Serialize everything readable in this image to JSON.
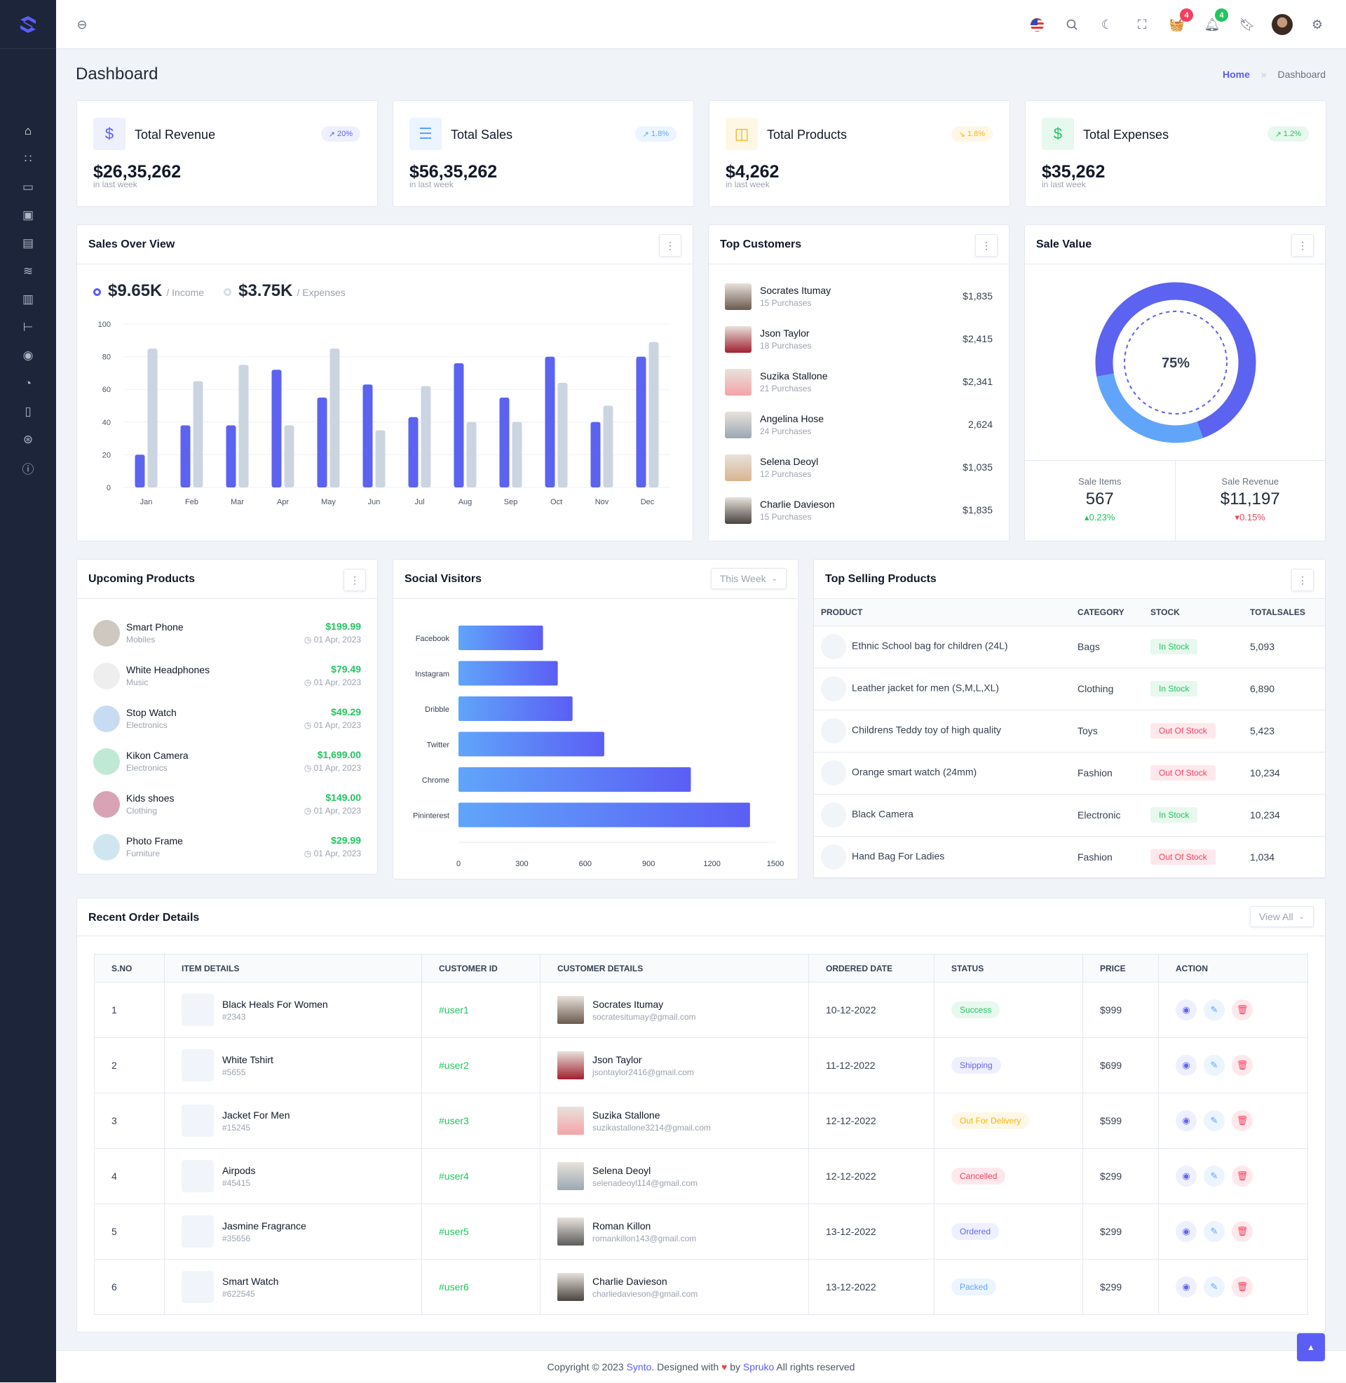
{
  "colors": {
    "primary": "#5b5ef4",
    "secondary": "#cbd5e1",
    "success": "#22c55e",
    "danger": "#ef4444",
    "warning": "#f59e0b",
    "info": "#60a5fa",
    "sidebar": "#1c2539"
  },
  "sidebar": {
    "items": [
      {
        "icon": "home-icon",
        "active": true
      },
      {
        "icon": "apps-icon"
      },
      {
        "icon": "inbox-icon"
      },
      {
        "icon": "chip-icon"
      },
      {
        "icon": "file-icon"
      },
      {
        "icon": "layers-icon"
      },
      {
        "icon": "report-icon"
      },
      {
        "icon": "tree-icon"
      },
      {
        "icon": "map-pin-icon"
      },
      {
        "icon": "pie-chart-icon"
      },
      {
        "icon": "book-icon"
      },
      {
        "icon": "aperture-icon"
      },
      {
        "icon": "alert-icon"
      }
    ]
  },
  "header": {
    "cart_count": "4",
    "notification_count": "4"
  },
  "page": {
    "title": "Dashboard",
    "breadcrumb": {
      "home": "Home",
      "sep": "»",
      "current": "Dashboard"
    }
  },
  "stats": [
    {
      "title": "Total Revenue",
      "value": "$26,35,262",
      "sub": "in last week",
      "change": "20%",
      "trend": "up",
      "color": "#5b5ef4",
      "bg": "#eef0ff",
      "icon": "receipt-dollar-icon",
      "glyph": "$"
    },
    {
      "title": "Total Sales",
      "value": "$56,35,262",
      "sub": "in last week",
      "change": "1.8%",
      "trend": "up",
      "color": "#60a5fa",
      "bg": "#ebf4ff",
      "icon": "receipt-icon",
      "glyph": "☰"
    },
    {
      "title": "Total Products",
      "value": "$4,262",
      "sub": "in last week",
      "change": "1.8%",
      "trend": "down",
      "color": "#f5b60b",
      "bg": "#fff7e6",
      "icon": "shopping-bag-icon",
      "glyph": "◫"
    },
    {
      "title": "Total Expenses",
      "value": "$35,262",
      "sub": "in last week",
      "change": "1.2%",
      "trend": "up",
      "color": "#22c55e",
      "bg": "#e7f8ee",
      "icon": "dollar-circle-icon",
      "glyph": "$"
    }
  ],
  "sales_overview": {
    "title": "Sales Over View",
    "income_value": "$9.65K",
    "income_label": "/ Income",
    "expense_value": "$3.75K",
    "expense_label": "/ Expenses"
  },
  "chart_data": [
    {
      "type": "bar",
      "categories": [
        "Jan",
        "Feb",
        "Mar",
        "Apr",
        "May",
        "Jun",
        "Jul",
        "Aug",
        "Sep",
        "Oct",
        "Nov",
        "Dec"
      ],
      "series": [
        {
          "name": "Income",
          "values": [
            20,
            38,
            38,
            72,
            55,
            63,
            43,
            76,
            55,
            80,
            40,
            80
          ],
          "color": "#5b63f0"
        },
        {
          "name": "Expenses",
          "values": [
            85,
            65,
            75,
            38,
            85,
            35,
            62,
            40,
            40,
            64,
            50,
            89
          ],
          "color": "#cbd5e1"
        }
      ],
      "ylim": [
        0,
        100
      ],
      "yticks": [
        0,
        20,
        40,
        60,
        80,
        100
      ],
      "grid": true
    },
    {
      "type": "bar",
      "orientation": "horizontal",
      "categories": [
        "Facebook",
        "Instagram",
        "Dribble",
        "Twitter",
        "Chrome",
        "Pininterest"
      ],
      "values": [
        400,
        470,
        540,
        690,
        1100,
        1380
      ],
      "xlim": [
        0,
        1500
      ],
      "xticks": [
        0,
        300,
        600,
        900,
        1200,
        1500
      ]
    },
    {
      "type": "pie",
      "variant": "donut",
      "label": "75%",
      "value": 75
    }
  ],
  "top_customers": {
    "title": "Top Customers",
    "items": [
      {
        "name": "Socrates Itumay",
        "sub": "15 Purchases",
        "amount": "$1,835",
        "color": "#6b5a4e"
      },
      {
        "name": "Json Taylor",
        "sub": "18 Purchases",
        "amount": "$2,415",
        "color": "#a0202f"
      },
      {
        "name": "Suzika Stallone",
        "sub": "21 Purchases",
        "amount": "$2,341",
        "color": "#f4a3a8"
      },
      {
        "name": "Angelina Hose",
        "sub": "24 Purchases",
        "amount": "2,624",
        "color": "#9aa8b3"
      },
      {
        "name": "Selena Deoyl",
        "sub": "12 Purchases",
        "amount": "$1,035",
        "color": "#d9b48f"
      },
      {
        "name": "Charlie Davieson",
        "sub": "15 Purchases",
        "amount": "$1,835",
        "color": "#4a4440"
      }
    ]
  },
  "sale_value": {
    "title": "Sale Value",
    "items_label": "Sale Items",
    "items_value": "567",
    "items_change": "0.23%",
    "revenue_label": "Sale Revenue",
    "revenue_value": "$11,197",
    "revenue_change": "0.15%"
  },
  "upcoming": {
    "title": "Upcoming Products",
    "items": [
      {
        "name": "Smart Phone",
        "sub": "Mobiles",
        "price": "$199.99",
        "date": "01 Apr, 2023",
        "color": "#cfc8c0"
      },
      {
        "name": "White Headphones",
        "sub": "Music",
        "price": "$79.49",
        "date": "01 Apr, 2023",
        "color": "#eeeeee"
      },
      {
        "name": "Stop Watch",
        "sub": "Electronics",
        "price": "$49.29",
        "date": "01 Apr, 2023",
        "color": "#c7dcf3"
      },
      {
        "name": "Kikon Camera",
        "sub": "Electronics",
        "price": "$1,699.00",
        "date": "01 Apr, 2023",
        "color": "#bfe9d4"
      },
      {
        "name": "Kids shoes",
        "sub": "Clothing",
        "price": "$149.00",
        "date": "01 Apr, 2023",
        "color": "#d8a3b4"
      },
      {
        "name": "Photo Frame",
        "sub": "Furniture",
        "price": "$29.99",
        "date": "01 Apr, 2023",
        "color": "#cfe6f0"
      }
    ]
  },
  "social": {
    "title": "Social Visitors",
    "filter": "This Week"
  },
  "top_selling": {
    "title": "Top Selling Products",
    "columns": [
      "PRODUCT",
      "CATEGORY",
      "STOCK",
      "TOTALSALES"
    ],
    "rows": [
      {
        "product": "Ethnic School bag for children (24L)",
        "category": "Bags",
        "stock": "In Stock",
        "sales": "5,093",
        "in": true
      },
      {
        "product": "Leather jacket for men (S,M,L,XL)",
        "category": "Clothing",
        "stock": "In Stock",
        "sales": "6,890",
        "in": true
      },
      {
        "product": "Childrens Teddy toy of high quality",
        "category": "Toys",
        "stock": "Out Of Stock",
        "sales": "5,423",
        "in": false
      },
      {
        "product": "Orange smart watch (24mm)",
        "category": "Fashion",
        "stock": "Out Of Stock",
        "sales": "10,234",
        "in": false
      },
      {
        "product": "Black Camera",
        "category": "Electronic",
        "stock": "In Stock",
        "sales": "10,234",
        "in": true
      },
      {
        "product": "Hand Bag For Ladies",
        "category": "Fashion",
        "stock": "Out Of Stock",
        "sales": "1,034",
        "in": false
      }
    ]
  },
  "orders": {
    "title": "Recent Order Details",
    "view_all": "View All",
    "columns": [
      "S.NO",
      "ITEM DETAILS",
      "CUSTOMER ID",
      "CUSTOMER DETAILS",
      "ORDERED DATE",
      "STATUS",
      "PRICE",
      "ACTION"
    ],
    "rows": [
      {
        "sno": "1",
        "item": "Black Heals For Women",
        "item_id": "#2343",
        "cid": "#user1",
        "cname": "Socrates Itumay",
        "email": "socratesitumay@gmail.com",
        "date": "10-12-2022",
        "status": "Success",
        "price": "$999",
        "sfg": "#22c55e",
        "sbg": "#e7f8ee",
        "av": "#6b5a4e"
      },
      {
        "sno": "2",
        "item": "White Tshirt",
        "item_id": "#5655",
        "cid": "#user2",
        "cname": "Json Taylor",
        "email": "jsontaylor2416@gmail.com",
        "date": "11-12-2022",
        "status": "Shipping",
        "price": "$699",
        "sfg": "#6366f1",
        "sbg": "#eef0ff",
        "av": "#a0202f"
      },
      {
        "sno": "3",
        "item": "Jacket For Men",
        "item_id": "#15245",
        "cid": "#user3",
        "cname": "Suzika Stallone",
        "email": "suzikastallone3214@gmail.com",
        "date": "12-12-2022",
        "status": "Out For Delivery",
        "price": "$599",
        "sfg": "#f5b60b",
        "sbg": "#fff7e6",
        "av": "#f4a3a8"
      },
      {
        "sno": "4",
        "item": "Airpods",
        "item_id": "#45415",
        "cid": "#user4",
        "cname": "Selena Deoyl",
        "email": "selenadeoyl114@gmail.com",
        "date": "12-12-2022",
        "status": "Cancelled",
        "price": "$299",
        "sfg": "#f43f5e",
        "sbg": "#ffe8ec",
        "av": "#9aa8b3"
      },
      {
        "sno": "5",
        "item": "Jasmine Fragrance",
        "item_id": "#35656",
        "cid": "#user5",
        "cname": "Roman Killon",
        "email": "romankillon143@gmail.com",
        "date": "13-12-2022",
        "status": "Ordered",
        "price": "$299",
        "sfg": "#6366f1",
        "sbg": "#eef0ff",
        "av": "#5c5c5c"
      },
      {
        "sno": "6",
        "item": "Smart Watch",
        "item_id": "#622545",
        "cid": "#user6",
        "cname": "Charlie Davieson",
        "email": "charliedavieson@gmail.com",
        "date": "13-12-2022",
        "status": "Packed",
        "price": "$299",
        "sfg": "#60a5fa",
        "sbg": "#ebf4ff",
        "av": "#4a4440"
      }
    ]
  },
  "footer": {
    "prefix": "Copyright © 2023",
    "brand": "Synto",
    "middle": ". Designed with",
    "by": "by",
    "company": "Spruko",
    "suffix": "All rights reserved"
  }
}
